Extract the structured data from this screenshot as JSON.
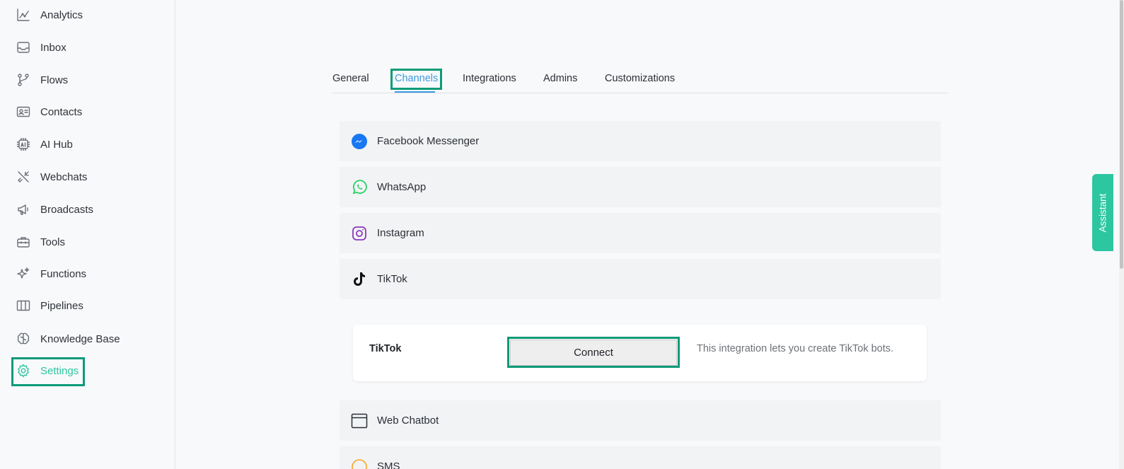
{
  "sidebar": {
    "items": [
      {
        "label": "Analytics",
        "icon": "analytics-icon"
      },
      {
        "label": "Inbox",
        "icon": "inbox-icon"
      },
      {
        "label": "Flows",
        "icon": "flows-icon"
      },
      {
        "label": "Contacts",
        "icon": "contacts-icon"
      },
      {
        "label": "AI Hub",
        "icon": "ai-chip-icon"
      },
      {
        "label": "Webchats",
        "icon": "tools-cross-icon"
      },
      {
        "label": "Broadcasts",
        "icon": "megaphone-icon"
      },
      {
        "label": "Tools",
        "icon": "toolbox-icon"
      },
      {
        "label": "Functions",
        "icon": "sparkle-icon"
      },
      {
        "label": "Pipelines",
        "icon": "columns-icon"
      },
      {
        "label": "Knowledge Base",
        "icon": "brain-icon"
      },
      {
        "label": "Settings",
        "icon": "gear-icon"
      }
    ],
    "active": "Settings"
  },
  "tabs": {
    "items": [
      "General",
      "Channels",
      "Integrations",
      "Admins",
      "Customizations"
    ],
    "active": "Channels"
  },
  "channels": [
    {
      "label": "Facebook Messenger",
      "icon": "messenger-icon"
    },
    {
      "label": "WhatsApp",
      "icon": "whatsapp-icon"
    },
    {
      "label": "Instagram",
      "icon": "instagram-icon"
    },
    {
      "label": "TikTok",
      "icon": "tiktok-icon"
    },
    {
      "label": "Web Chatbot",
      "icon": "browser-window-icon"
    },
    {
      "label": "SMS",
      "icon": "sms-icon"
    }
  ],
  "expanded_card": {
    "title": "TikTok",
    "button_label": "Connect",
    "description": "This integration lets you create TikTok bots."
  },
  "assistant": {
    "label": "Assistant"
  },
  "colors": {
    "accent": "#2cc6a0",
    "tab_active": "#3d9be0",
    "highlight_border": "#0c9b78",
    "messenger": "#1877f2",
    "whatsapp": "#25d366",
    "instagram": "#8a3ab9",
    "sms": "#f5a623"
  }
}
